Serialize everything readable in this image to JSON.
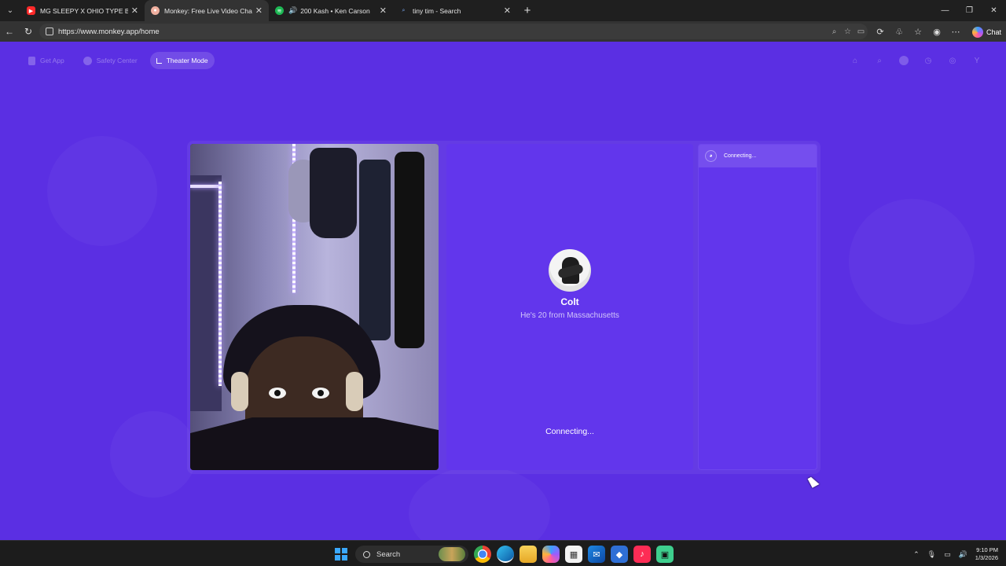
{
  "browser": {
    "tabs": [
      {
        "title": "MG SLEEPY X OHIO TYPE BEAT (F",
        "favicon_color": "#ff2a2a",
        "active": false,
        "audio": false
      },
      {
        "title": "Monkey: Free Live Video Chat",
        "favicon_color": "#d44",
        "active": true,
        "audio": false
      },
      {
        "title": "200 Kash • Ken Carson",
        "favicon_color": "#1db954",
        "active": false,
        "audio": true
      },
      {
        "title": "tiny tim - Search",
        "favicon_color": "#3a7bd5",
        "active": false,
        "audio": false
      }
    ],
    "url": "https://www.monkey.app/home",
    "chat_label": "Chat"
  },
  "page": {
    "nav": {
      "get_app": "Get App",
      "safety_center": "Safety Center",
      "theater_mode": "Theater Mode"
    },
    "right_icons": [
      "home-icon",
      "search-icon",
      "avatar-icon",
      "history-icon",
      "chat-icon",
      "user-initial"
    ],
    "user_initial": "Y",
    "remote": {
      "name": "Colt",
      "info": "He's 20 from Massachusetts",
      "status": "Connecting..."
    },
    "chat": {
      "status": "Connecting..."
    },
    "colors": {
      "background": "#5b2fe3",
      "panel": "#6236ec"
    }
  },
  "taskbar": {
    "search_placeholder": "Search",
    "apps": [
      "chrome-icon",
      "edge-icon",
      "file-explorer-icon",
      "copilot-icon",
      "store-icon",
      "mail-icon",
      "app-icon",
      "tiktok-icon",
      "greenapp-icon"
    ],
    "time": "9:10 PM",
    "date": "1/3/2026"
  }
}
